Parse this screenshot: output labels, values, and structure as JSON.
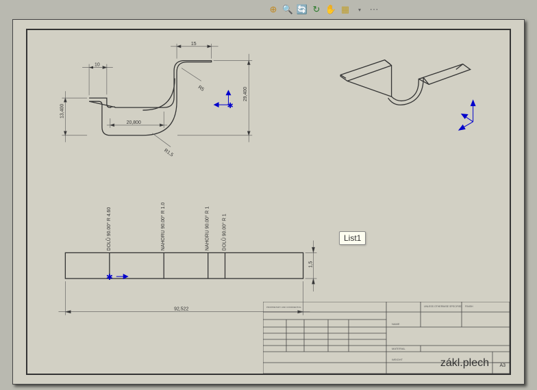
{
  "toolbar": {
    "icons": [
      "zoom-fit",
      "zoom-area",
      "rotate",
      "refresh",
      "pan",
      "display",
      "arrow",
      "options"
    ]
  },
  "tooltip": "List1",
  "dimensions": {
    "top_d1": "10",
    "top_d2": "15",
    "left_height": "13,400",
    "mid_width": "20,800",
    "overall_height": "29,400",
    "r1": "R5",
    "r2": "R1,5",
    "flat_thickness": "1,5",
    "flat_length": "92,522",
    "bend1": "DOLŮ 90.00° R 4.60",
    "bend2": "NAHORU 90.00° R 1.0",
    "bend3": "NAHORU 90.00° R 1",
    "bend4": "DOLŮ 90.00° R 1"
  },
  "title_block": {
    "part_name": "zákl.plech",
    "format": "A3"
  }
}
